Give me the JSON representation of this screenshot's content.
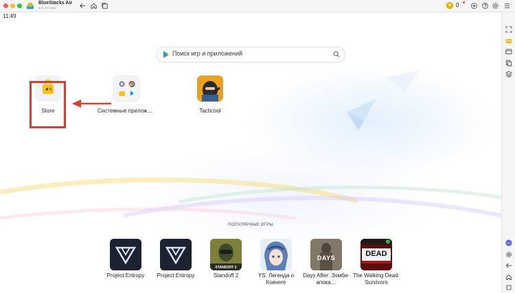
{
  "window": {
    "app_name": "BlueStacks Air",
    "version": "5.21.7??.7001",
    "coins": "0"
  },
  "status": {
    "time": "11:49"
  },
  "search": {
    "placeholder": "Поиск игр и приложений"
  },
  "home_apps": [
    {
      "label": "Store",
      "icon": "store-icon"
    },
    {
      "label": "Системные приложен…",
      "icon": "system-apps-icon"
    },
    {
      "label": "Tacticool",
      "icon": "tacticool-icon"
    }
  ],
  "popular": {
    "title": "ПОПУЛЯРНЫЕ ИГРЫ",
    "games": [
      {
        "name": "Project Entropy"
      },
      {
        "name": "Project Entropy"
      },
      {
        "name": "Standoff 2",
        "thumb_text": "STANDOFF 2"
      },
      {
        "name": "YS: Легенда о Ковчеге"
      },
      {
        "name": "Days After: Зомби-апока…",
        "thumb_text": "DAYS"
      },
      {
        "name": "The Walking Dead: Survivors",
        "thumb_text": "DEAD"
      }
    ]
  },
  "titlebar_icons": [
    "back-icon",
    "home-icon",
    "multi-instance-icon",
    "coin-icon",
    "notification-icon",
    "help-icon",
    "settings-icon",
    "menu-icon"
  ],
  "sidebar_icons": [
    "fullscreen-icon",
    "keymapping-icon",
    "media-manager-icon",
    "screenshot-icon",
    "layers-icon",
    "discord-icon",
    "settings-icon",
    "back-icon",
    "home-icon",
    "recent-apps-icon"
  ],
  "colors": {
    "highlight": "#e53a2b",
    "accent": "#f6b700"
  }
}
